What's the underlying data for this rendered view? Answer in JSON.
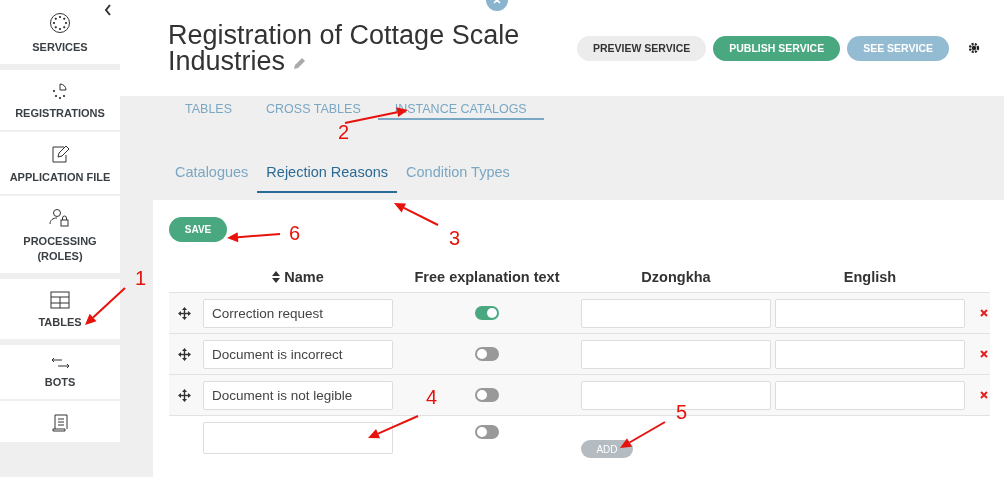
{
  "sidebar": {
    "items": [
      {
        "label": "SERVICES",
        "selected": false
      },
      {
        "label": "REGISTRATIONS",
        "selected": false
      },
      {
        "label": "APPLICATION FILE",
        "selected": false
      },
      {
        "label": "PROCESSING (ROLES)",
        "selected": false
      },
      {
        "label": "TABLES",
        "selected": false
      },
      {
        "label": "BOTS",
        "selected": false
      }
    ]
  },
  "header": {
    "title": "Registration of Cottage Scale Industries",
    "buttons": [
      {
        "label": "PREVIEW SERVICE",
        "kind": "light"
      },
      {
        "label": "PUBLISH SERVICE",
        "kind": "green"
      },
      {
        "label": "SEE SERVICE",
        "kind": "blue"
      }
    ]
  },
  "top_tabs": [
    {
      "label": "TABLES",
      "selected": false
    },
    {
      "label": "CROSS TABLES",
      "selected": false
    },
    {
      "label": "INSTANCE CATALOGS",
      "selected": true
    }
  ],
  "sub_tabs": [
    {
      "label": "Catalogues",
      "selected": false
    },
    {
      "label": "Rejection Reasons",
      "selected": true
    },
    {
      "label": "Condition Types",
      "selected": false
    }
  ],
  "save_button": "SAVE",
  "table": {
    "columns": [
      "Name",
      "Free explanation text",
      "Dzongkha",
      "English"
    ],
    "rows": [
      {
        "name": "Correction request",
        "free_text": true
      },
      {
        "name": "Document is incorrect",
        "free_text": false
      },
      {
        "name": "Document is not legible",
        "free_text": false
      }
    ],
    "new_row": {
      "free_text": false,
      "add_button": "ADD"
    }
  },
  "annotations": [
    "1",
    "2",
    "3",
    "4",
    "5",
    "6"
  ]
}
